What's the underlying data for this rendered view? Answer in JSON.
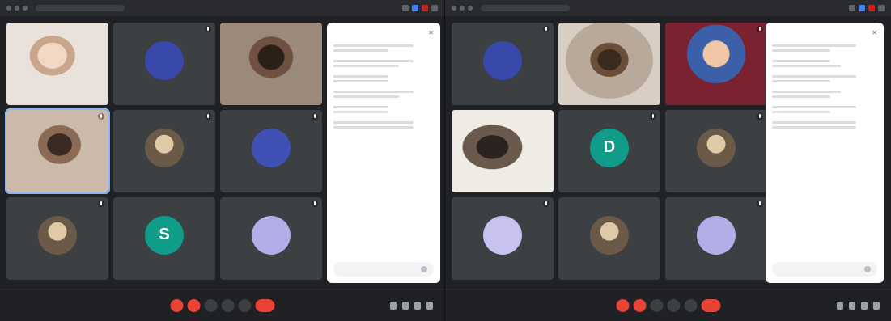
{
  "colors": {
    "background": "#202124",
    "tile": "#3c4043",
    "accent": "#8ab4f8",
    "danger": "#ea4335",
    "chat_bg": "#ffffff"
  },
  "left": {
    "tiles": [
      {
        "kind": "video",
        "variant": "v1",
        "name": "",
        "active": false
      },
      {
        "kind": "avatar",
        "avatar_style": "blue",
        "initial": "",
        "name": ""
      },
      {
        "kind": "video",
        "variant": "v3",
        "name": ""
      },
      {
        "kind": "video",
        "variant": "v4",
        "name": "",
        "active": true
      },
      {
        "kind": "avatar",
        "avatar_style": "photo",
        "initial": "",
        "name": ""
      },
      {
        "kind": "avatar",
        "avatar_style": "logo",
        "initial": "",
        "name": ""
      },
      {
        "kind": "avatar",
        "avatar_style": "photo",
        "initial": "",
        "name": ""
      },
      {
        "kind": "avatar",
        "avatar_style": "teal",
        "initial": "S",
        "name": ""
      },
      {
        "kind": "avatar",
        "avatar_style": "lavender",
        "initial": "",
        "name": ""
      }
    ],
    "chat": {
      "title": "",
      "messages": [
        {},
        {},
        {},
        {},
        {},
        {}
      ],
      "compose_placeholder": ""
    },
    "bottom": {
      "meeting_info": ""
    }
  },
  "right": {
    "tiles": [
      {
        "kind": "avatar",
        "avatar_style": "blue",
        "initial": "",
        "name": ""
      },
      {
        "kind": "video",
        "variant": "v2",
        "name": ""
      },
      {
        "kind": "video",
        "variant": "v5",
        "name": ""
      },
      {
        "kind": "video",
        "variant": "v6",
        "name": ""
      },
      {
        "kind": "avatar",
        "avatar_style": "teal",
        "initial": "D",
        "name": ""
      },
      {
        "kind": "avatar",
        "avatar_style": "photo",
        "initial": "",
        "name": ""
      },
      {
        "kind": "avatar",
        "avatar_style": "lilac",
        "initial": "",
        "name": ""
      },
      {
        "kind": "avatar",
        "avatar_style": "photo",
        "initial": "",
        "name": ""
      },
      {
        "kind": "avatar",
        "avatar_style": "lavender",
        "initial": "",
        "name": ""
      }
    ],
    "chat": {
      "title": "",
      "messages": [
        {},
        {},
        {},
        {},
        {},
        {}
      ],
      "compose_placeholder": ""
    },
    "bottom": {
      "meeting_info": ""
    }
  },
  "icons": {
    "mic": "microphone-icon",
    "camera": "camera-icon",
    "captions": "captions-icon",
    "present": "present-icon",
    "more": "more-options-icon",
    "end": "end-call-icon",
    "info": "info-icon",
    "people": "people-icon",
    "chat": "chat-icon",
    "activities": "activities-icon",
    "close": "close-icon",
    "send": "send-icon"
  }
}
